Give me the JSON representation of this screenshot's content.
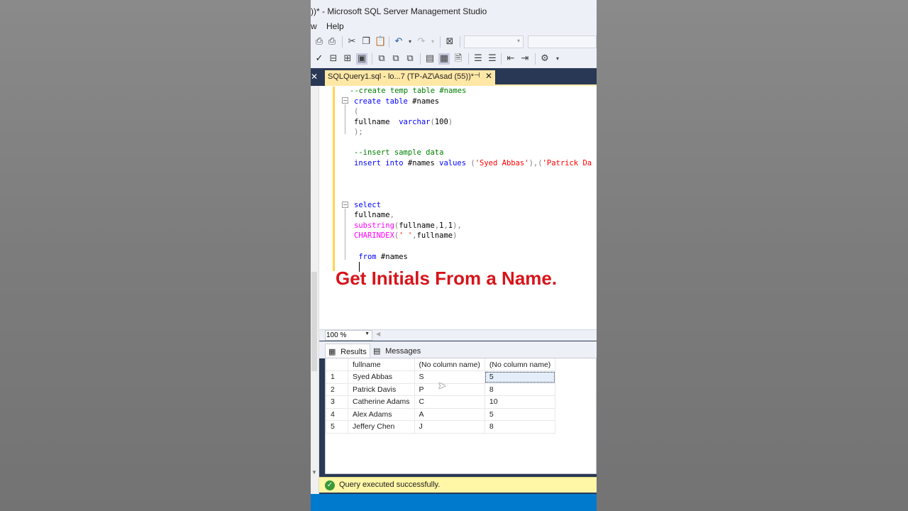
{
  "window": {
    "title": "))* - Microsoft SQL Server Management Studio"
  },
  "menu": {
    "items": [
      "w",
      "Help"
    ]
  },
  "toolbar": {
    "icons": [
      "new-query-sml-icon",
      "new-query-dax-icon",
      "cut-icon",
      "copy-icon",
      "paste-icon",
      "undo-icon",
      "redo-icon",
      "solution-explorer-icon"
    ]
  },
  "editor_tab": {
    "label": "SQLQuery1.sql - lo...7 (TP-AZ\\Asad (55))*",
    "pin": "⊣",
    "close": "✕"
  },
  "code": {
    "lines": [
      {
        "segments": [
          {
            "t": "--create temp table #names",
            "c": "cm"
          }
        ]
      },
      {
        "segments": [
          {
            "t": "create table",
            "c": "kw"
          },
          {
            "t": " #names",
            "c": "tx"
          }
        ]
      },
      {
        "segments": [
          {
            "t": "(",
            "c": "gr"
          }
        ]
      },
      {
        "segments": [
          {
            "t": "fullname  ",
            "c": "tx"
          },
          {
            "t": "varchar",
            "c": "kw"
          },
          {
            "t": "(",
            "c": "gr"
          },
          {
            "t": "100",
            "c": "tx"
          },
          {
            "t": ")",
            "c": "gr"
          }
        ]
      },
      {
        "segments": [
          {
            "t": ");",
            "c": "gr"
          }
        ]
      },
      {
        "segments": []
      },
      {
        "segments": [
          {
            "t": "--insert sample data",
            "c": "cm"
          }
        ]
      },
      {
        "segments": [
          {
            "t": "insert into",
            "c": "kw"
          },
          {
            "t": " #names ",
            "c": "tx"
          },
          {
            "t": "values",
            "c": "kw"
          },
          {
            "t": " (",
            "c": "gr"
          },
          {
            "t": "'Syed Abbas'",
            "c": "st"
          },
          {
            "t": "),(",
            "c": "gr"
          },
          {
            "t": "'Patrick Da",
            "c": "st"
          }
        ]
      },
      {
        "segments": []
      },
      {
        "segments": []
      },
      {
        "segments": []
      },
      {
        "segments": []
      },
      {
        "segments": [
          {
            "t": "select",
            "c": "kw"
          }
        ]
      },
      {
        "segments": [
          {
            "t": "fullname",
            "c": "tx"
          },
          {
            "t": ",",
            "c": "gr"
          }
        ]
      },
      {
        "segments": [
          {
            "t": "substring",
            "c": "fn"
          },
          {
            "t": "(",
            "c": "gr"
          },
          {
            "t": "fullname",
            "c": "tx"
          },
          {
            "t": ",",
            "c": "gr"
          },
          {
            "t": "1",
            "c": "tx"
          },
          {
            "t": ",",
            "c": "gr"
          },
          {
            "t": "1",
            "c": "tx"
          },
          {
            "t": "),",
            "c": "gr"
          }
        ]
      },
      {
        "segments": [
          {
            "t": "CHARINDEX",
            "c": "fn"
          },
          {
            "t": "(",
            "c": "gr"
          },
          {
            "t": "' '",
            "c": "st"
          },
          {
            "t": ",",
            "c": "gr"
          },
          {
            "t": "fullname",
            "c": "tx"
          },
          {
            "t": ")",
            "c": "gr"
          }
        ]
      },
      {
        "segments": []
      },
      {
        "segments": [
          {
            "t": " from",
            "c": "kw"
          },
          {
            "t": " #names",
            "c": "tx"
          }
        ]
      }
    ]
  },
  "overlay_title": "Get Initials From a Name.",
  "zoom": {
    "value": "100 %"
  },
  "results_tabs": {
    "results": "Results",
    "messages": "Messages"
  },
  "grid": {
    "columns": [
      "fullname",
      "(No column name)",
      "(No column name)"
    ],
    "rows": [
      {
        "n": "1",
        "cells": [
          "Syed Abbas",
          "S",
          "5"
        ]
      },
      {
        "n": "2",
        "cells": [
          "Patrick Davis",
          "P",
          "8"
        ]
      },
      {
        "n": "3",
        "cells": [
          "Catherine Adams",
          "C",
          "10"
        ]
      },
      {
        "n": "4",
        "cells": [
          "Alex Adams",
          "A",
          "5"
        ]
      },
      {
        "n": "5",
        "cells": [
          "Jeffery Chen",
          "J",
          "8"
        ]
      }
    ]
  },
  "status": {
    "message": "Query executed successfully.",
    "color": "#fff6a6"
  },
  "colors": {
    "accent": "#007acc",
    "doc_well": "#293955",
    "tab_active": "#ffe8a6",
    "overlay_text": "#d7141a"
  }
}
